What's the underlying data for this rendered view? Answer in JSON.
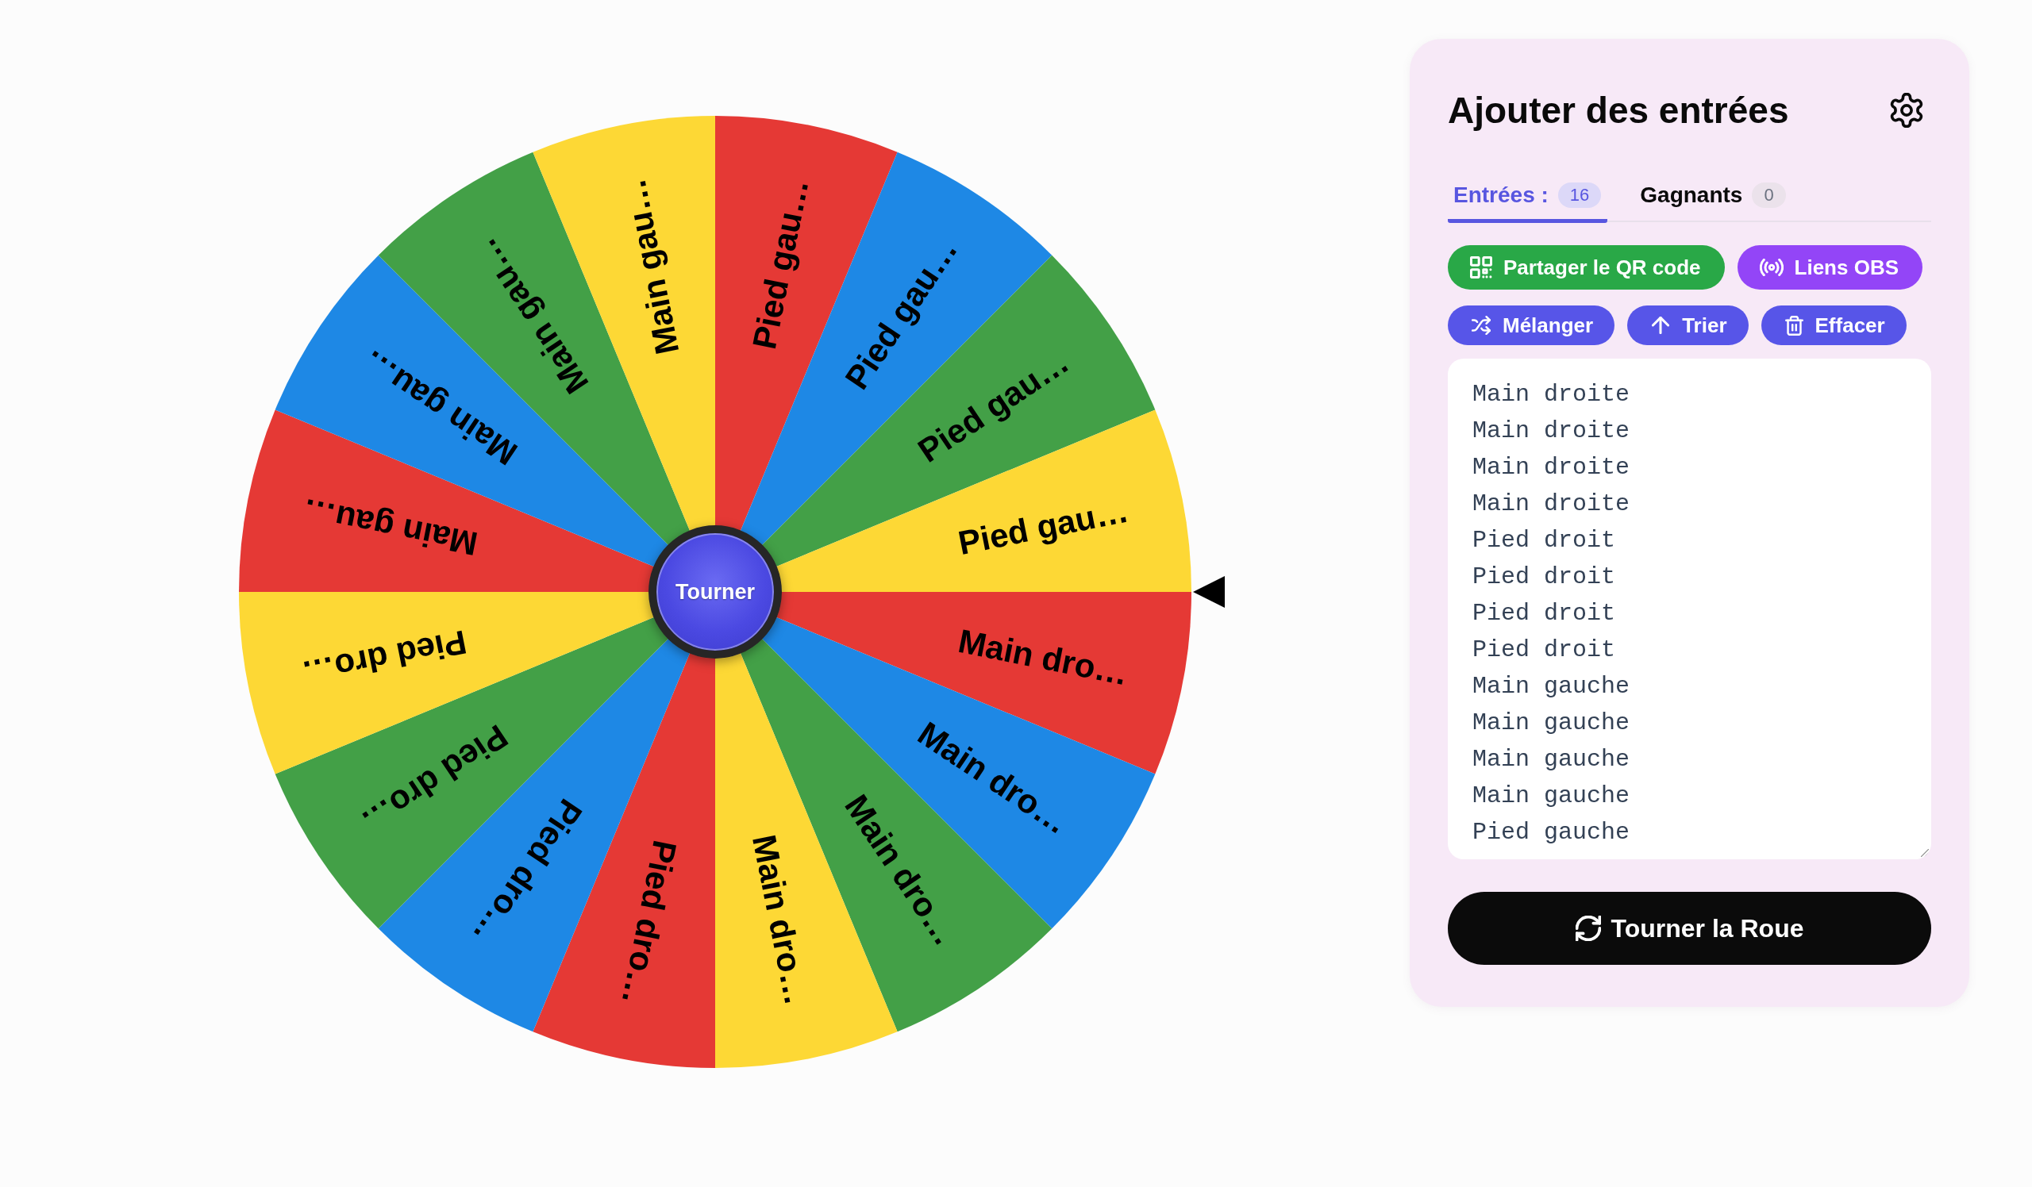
{
  "wheel": {
    "segments": [
      {
        "label": "Main dro…",
        "color": "#e53935"
      },
      {
        "label": "Main dro…",
        "color": "#1e88e5"
      },
      {
        "label": "Main dro…",
        "color": "#43a047"
      },
      {
        "label": "Main dro…",
        "color": "#fdd835"
      },
      {
        "label": "Pied dro…",
        "color": "#e53935"
      },
      {
        "label": "Pied dro…",
        "color": "#1e88e5"
      },
      {
        "label": "Pied dro…",
        "color": "#43a047"
      },
      {
        "label": "Pied dro…",
        "color": "#fdd835"
      },
      {
        "label": "Main gau…",
        "color": "#e53935"
      },
      {
        "label": "Main gau…",
        "color": "#1e88e5"
      },
      {
        "label": "Main gau…",
        "color": "#43a047"
      },
      {
        "label": "Main gau…",
        "color": "#fdd835"
      },
      {
        "label": "Pied gau…",
        "color": "#e53935"
      },
      {
        "label": "Pied gau…",
        "color": "#1e88e5"
      },
      {
        "label": "Pied gau…",
        "color": "#43a047"
      },
      {
        "label": "Pied gau…",
        "color": "#fdd835"
      }
    ],
    "center_button": "Tourner"
  },
  "panel": {
    "title": "Ajouter des entrées",
    "tabs": [
      {
        "label": "Entrées :",
        "count": "16",
        "selected": true
      },
      {
        "label": "Gagnants",
        "count": "0",
        "selected": false
      }
    ],
    "share_buttons": [
      {
        "label": "Partager le QR code",
        "kind": "qr"
      },
      {
        "label": "Liens OBS",
        "kind": "obs"
      }
    ],
    "list_tools": [
      {
        "label": "Mélanger",
        "kind": "shuffle"
      },
      {
        "label": "Trier",
        "kind": "sort"
      },
      {
        "label": "Effacer",
        "kind": "clear"
      }
    ],
    "entries": [
      "Main droite",
      "Main droite",
      "Main droite",
      "Main droite",
      "Pied droit",
      "Pied droit",
      "Pied droit",
      "Pied droit",
      "Main gauche",
      "Main gauche",
      "Main gauche",
      "Main gauche",
      "Pied gauche"
    ],
    "spin_button": "Tourner la Roue"
  }
}
